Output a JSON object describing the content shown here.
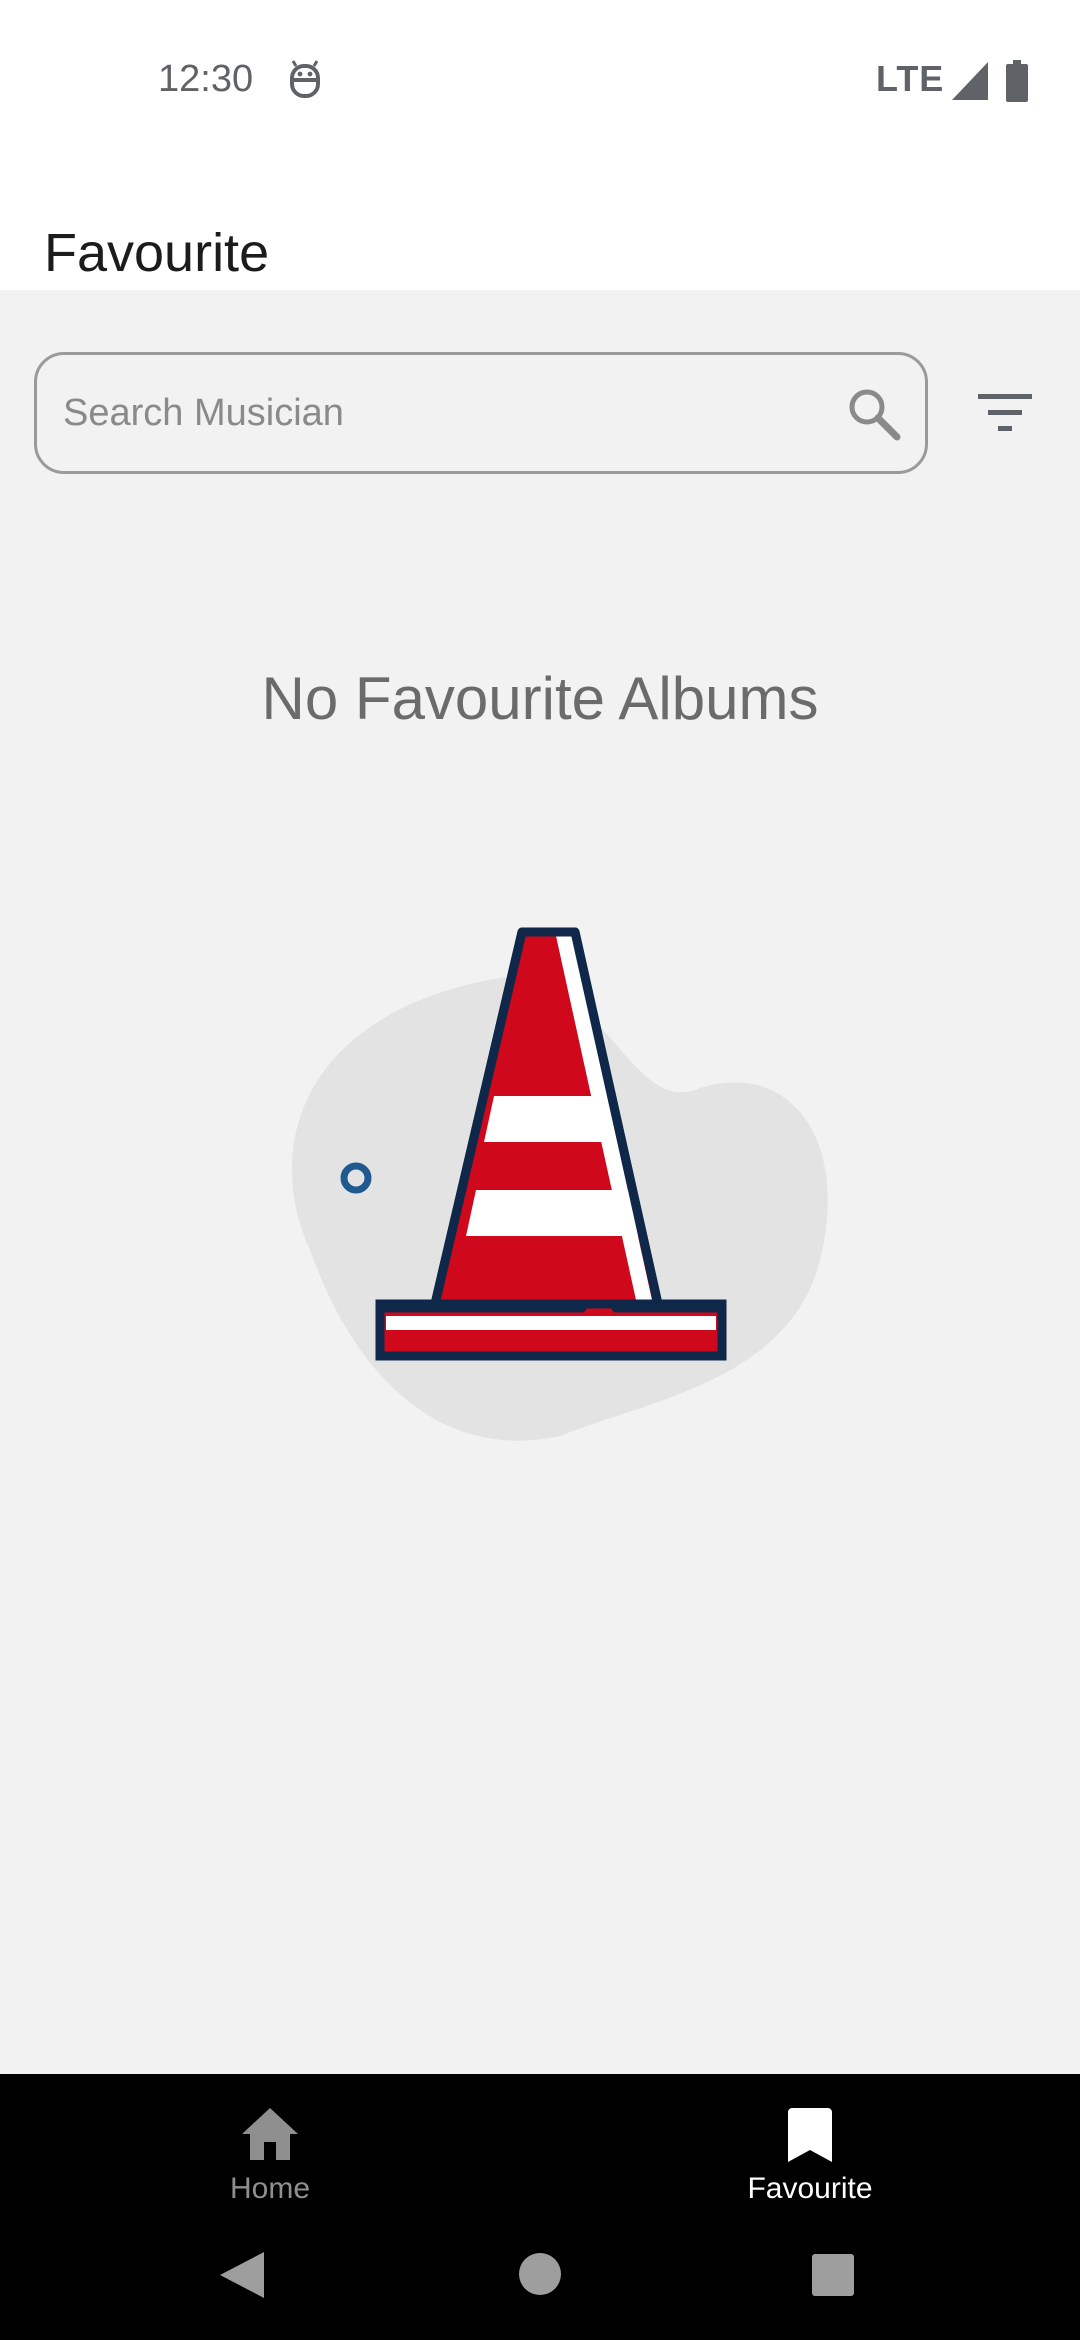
{
  "status_bar": {
    "time": "12:30",
    "network": "LTE",
    "icons": [
      "android-robot-icon",
      "signal-icon",
      "battery-icon"
    ]
  },
  "app_bar": {
    "title": "Favourite"
  },
  "search": {
    "placeholder": "Search Musician",
    "value": "",
    "icon": "search-icon",
    "filter_icon": "filter-icon"
  },
  "empty_state": {
    "message": "No Favourite Albums",
    "illustration": "traffic-cone-illustration"
  },
  "bottom_nav": {
    "items": [
      {
        "label": "Home",
        "icon": "home-icon",
        "selected": false
      },
      {
        "label": "Favourite",
        "icon": "bookmark-icon",
        "selected": true
      }
    ]
  },
  "system_nav": {
    "icons": [
      "back-icon",
      "home-circle-icon",
      "recent-apps-icon"
    ]
  },
  "colors": {
    "cone_red": "#d0081c",
    "cone_outline": "#0f2748",
    "blob": "#e3e3e3",
    "dot": "#1e5a8e"
  }
}
